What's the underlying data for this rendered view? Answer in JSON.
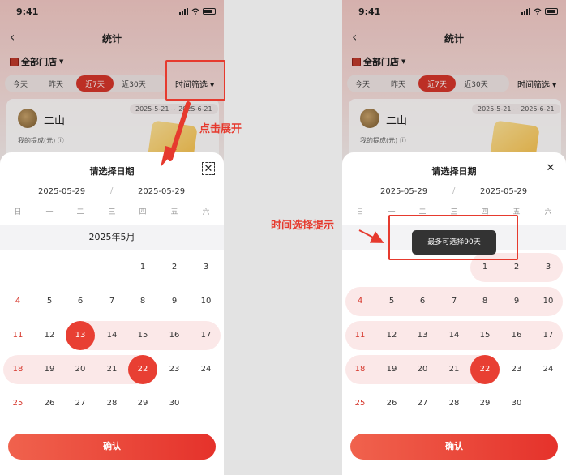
{
  "status_time": "9:41",
  "nav": {
    "back_glyph": "‹",
    "title": "统计"
  },
  "store_label": "全部门店",
  "chips": [
    "今天",
    "昨天",
    "近7天",
    "近30天"
  ],
  "active_chip_index": 2,
  "time_filter": "时间筛选 ▾",
  "card": {
    "name": "二山",
    "range": "2025-5-21 ~ 2025-6-21",
    "earn_label": "我的提成(元) ⓘ"
  },
  "sheet": {
    "title": "请选择日期",
    "close_glyph": "✕",
    "from": "2025-05-29",
    "sep": "/",
    "to": "2025-05-29",
    "weekdays": [
      "日",
      "一",
      "二",
      "三",
      "四",
      "五",
      "六"
    ],
    "month": "2025年5月",
    "confirm": "确认"
  },
  "calendar": {
    "rows": [
      [
        null,
        null,
        null,
        null,
        "1",
        "2",
        "3"
      ],
      [
        "4",
        "5",
        "6",
        "7",
        "8",
        "9",
        "10"
      ],
      [
        "11",
        "12",
        "13",
        "14",
        "15",
        "16",
        "17"
      ],
      [
        "18",
        "19",
        "20",
        "21",
        "22",
        "23",
        "24"
      ],
      [
        "25",
        "26",
        "27",
        "28",
        "29",
        "30",
        null
      ]
    ]
  },
  "left_panel": {
    "selected": [
      "13",
      "22"
    ]
  },
  "right_panel": {
    "selected": [
      "22"
    ],
    "toast": "最多可选择90天"
  },
  "annotations": {
    "expand": "点击展开",
    "tip": "时间选择提示"
  },
  "colors": {
    "accent": "#e83f33",
    "highlight": "#fbe8e8",
    "annotation": "#e63a2e"
  }
}
